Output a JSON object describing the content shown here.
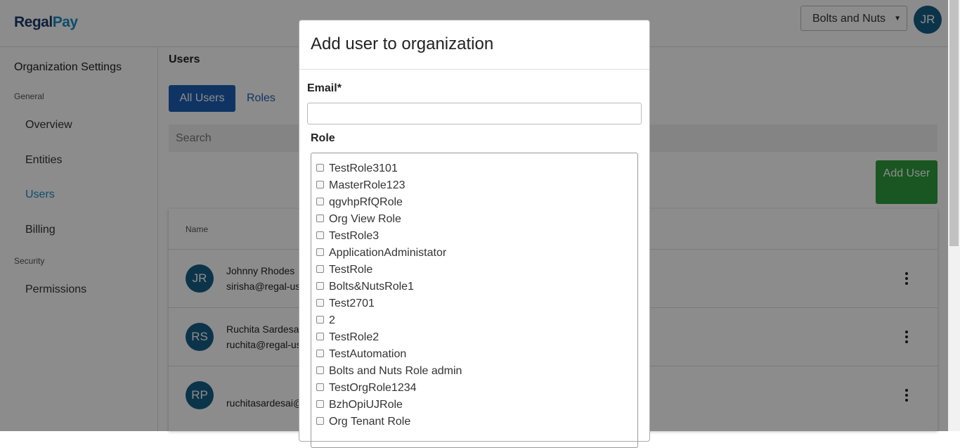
{
  "brand": {
    "logo_part1": "Regal",
    "logo_part2": "Pay"
  },
  "header": {
    "org_selected": "Bolts and Nuts",
    "user_initials": "JR"
  },
  "sidebar": {
    "title": "Organization Settings",
    "general_label": "General",
    "items": [
      "Overview",
      "Entities",
      "Users",
      "Billing"
    ],
    "security_label": "Security",
    "security_items": [
      "Permissions"
    ]
  },
  "main": {
    "title": "Users",
    "tabs": [
      "All Users",
      "Roles"
    ],
    "search_placeholder": "Search",
    "add_user_button": "Add User",
    "table_header_name": "Name",
    "rows": [
      {
        "initials": "JR",
        "name": "Johnny Rhodes",
        "email": "sirisha@regal-us"
      },
      {
        "initials": "RS",
        "name": "Ruchita Sardesai",
        "email": "ruchita@regal-us"
      },
      {
        "initials": "RP",
        "name": "",
        "email": "ruchitasardesai@"
      }
    ]
  },
  "modal": {
    "title": "Add user to organization",
    "email_label": "Email*",
    "email_value": "",
    "role_label": "Role",
    "roles": [
      "TestRole3101",
      "MasterRole123",
      "qgvhpRfQRole",
      "Org View Role",
      "TestRole3",
      "ApplicationAdministator",
      "TestRole",
      "Bolts&NutsRole1",
      "Test2701",
      "2",
      "TestRole2",
      "TestAutomation",
      "Bolts and Nuts Role admin",
      "TestOrgRole1234",
      "BzhOpiUJRole",
      "Org Tenant Role"
    ]
  },
  "colors": {
    "primary": "#1c5fb5",
    "success": "#2e9d3c",
    "avatar": "#155f87",
    "link": "#1d8bc4"
  }
}
